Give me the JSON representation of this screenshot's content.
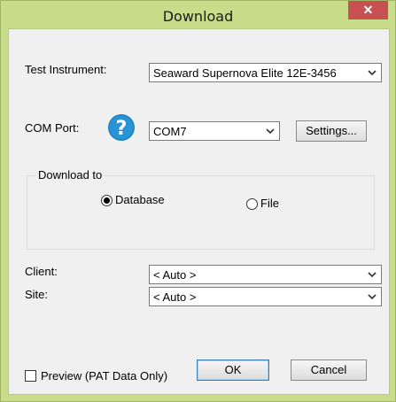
{
  "window": {
    "title": "Download",
    "close_glyph": "✕",
    "frame_color": "#c9dc8a",
    "close_color": "#c75050"
  },
  "test_instrument": {
    "label": "Test Instrument:",
    "value": "Seaward Supernova Elite 12E-3456"
  },
  "com_port": {
    "label": "COM Port:",
    "help_icon": "question-mark-icon",
    "value": "COM7",
    "settings_label": "Settings..."
  },
  "download_to": {
    "group_label": "Download to",
    "options": [
      {
        "label": "Database",
        "selected": true
      },
      {
        "label": "File",
        "selected": false
      }
    ]
  },
  "client": {
    "label": "Client:",
    "value": "< Auto >"
  },
  "site": {
    "label": "Site:",
    "value": "< Auto >"
  },
  "footer": {
    "preview_label": "Preview (PAT Data Only)",
    "preview_checked": false,
    "ok_label": "OK",
    "cancel_label": "Cancel"
  }
}
